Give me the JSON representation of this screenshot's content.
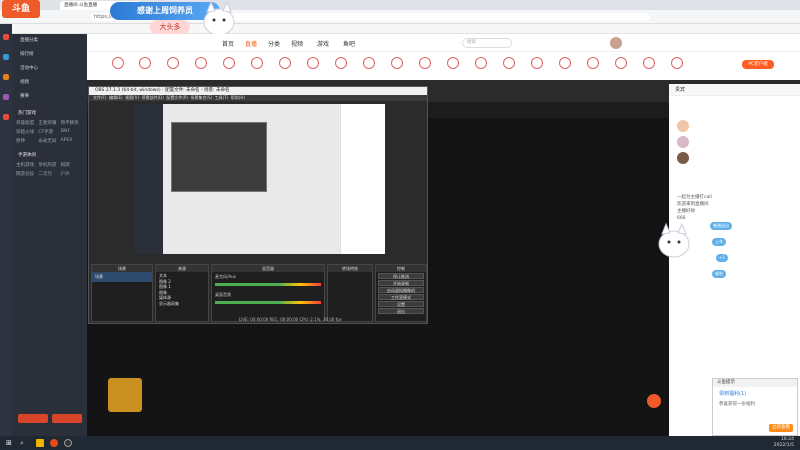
{
  "browser": {
    "tab_title": "直播间-斗鱼直播",
    "url": "https://www.douyu.com/"
  },
  "watermark": {
    "logo": "斗鱼",
    "banner_text": "感谢上周饲养员",
    "banner_name": "大头多"
  },
  "sidebar": {
    "items": [
      {
        "label": "直播分类"
      },
      {
        "label": "排行榜"
      },
      {
        "label": "活动中心"
      },
      {
        "label": "视频"
      },
      {
        "label": "赛事"
      }
    ],
    "groups": [
      {
        "title": "热门游戏",
        "items": [
          "英雄联盟",
          "王者荣耀",
          "和平精英",
          "穿越火线",
          "CF手游",
          "DNF",
          "原神",
          "永劫无间",
          "APEX"
        ]
      },
      {
        "title": "手游休闲",
        "items": [
          "主机游戏",
          "单机热游",
          "棋牌",
          "网游竞技",
          "二次元",
          "户外"
        ]
      }
    ]
  },
  "site": {
    "nav": [
      "首页",
      "直播",
      "分类",
      "视频",
      "游戏",
      "鱼吧"
    ],
    "search_placeholder": "搜索"
  },
  "obs": {
    "title": "OBS 27.1.3 (64-bit, windows) - 配置文件: 未命名 - 场景: 未命名",
    "menus": [
      "文件(F)",
      "编辑(E)",
      "视图(V)",
      "停靠部件(D)",
      "配置文件(P)",
      "场景集合(S)",
      "工具(T)",
      "帮助(H)"
    ],
    "panels": {
      "scenes": "场景",
      "sources": "来源",
      "mixer": "混音器",
      "transitions": "转场特效",
      "controls": "控制"
    },
    "scene_name": "场景",
    "sources": [
      "文本",
      "图像 2",
      "图像 1",
      "图像",
      "媒体源",
      "显示器采集"
    ],
    "mixer_tracks": [
      "麦克风/Aux",
      "桌面音频"
    ],
    "controls": [
      "停止推流",
      "开始录制",
      "启动虚拟摄像机",
      "工作室模式",
      "设置",
      "退出"
    ],
    "status": "LIVE: 00:00:00  REC: 00:00:00  CPU: 2.1%, 30.00 fps"
  },
  "chat": {
    "header": "PC客户端",
    "rank_tab": "贵宾",
    "messages": [
      "一起为主播打call",
      "欢迎来到直播间",
      "主播好帅",
      "666"
    ],
    "gift_pills": [
      "感谢送出",
      "上车",
      "+1",
      "福利"
    ]
  },
  "popup": {
    "title": "斗鱼提示",
    "line1": "领到福利(1)",
    "line2": "恭喜获得一份福利",
    "button": "立即查看"
  },
  "clock": {
    "time": "16:24",
    "date": "2022/1/5"
  },
  "colors": {
    "accent": "#ff5d23",
    "sidebar": "#2a2f3a",
    "obs_bg": "#2b2b2b"
  }
}
